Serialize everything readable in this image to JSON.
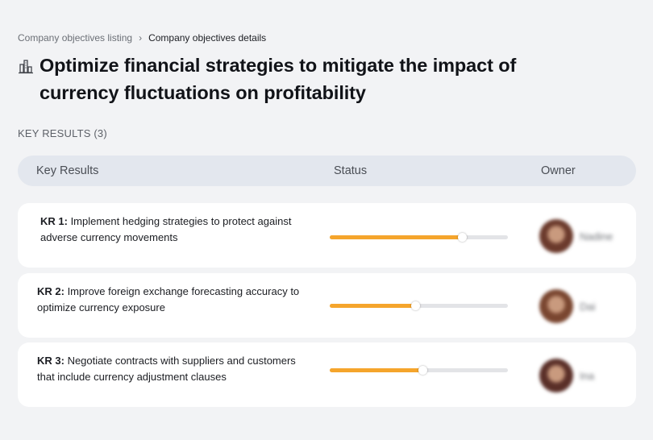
{
  "breadcrumb": {
    "parent": "Company objectives listing",
    "separator": "›",
    "current": "Company objectives details"
  },
  "objective": {
    "title": "Optimize financial strategies to mitigate the impact of currency fluctuations on profitability",
    "icon": "building-chart-icon"
  },
  "key_results_section": {
    "label": "KEY RESULTS (3)"
  },
  "table": {
    "headers": {
      "key_results": "Key Results",
      "status": "Status",
      "owner": "Owner"
    }
  },
  "key_results": [
    {
      "id": "KR 1:",
      "text": " Implement hedging strategies to protect against adverse currency movements",
      "progress": 0.74,
      "owner": "Nadine",
      "avatar_color": "#6b3a2c"
    },
    {
      "id": "KR 2:",
      "text": " Improve foreign exchange forecasting accuracy to optimize currency exposure",
      "progress": 0.48,
      "owner": "Dai",
      "avatar_color": "#7a4630"
    },
    {
      "id": "KR 3:",
      "text": " Negotiate contracts with suppliers and customers that include currency adjustment clauses",
      "progress": 0.52,
      "owner": "Ina",
      "avatar_color": "#5a2f28"
    }
  ],
  "colors": {
    "background": "#f2f3f5",
    "progress_fill": "#f5a52c",
    "progress_track": "#e3e4e7",
    "header_bg": "#e3e7ee"
  }
}
